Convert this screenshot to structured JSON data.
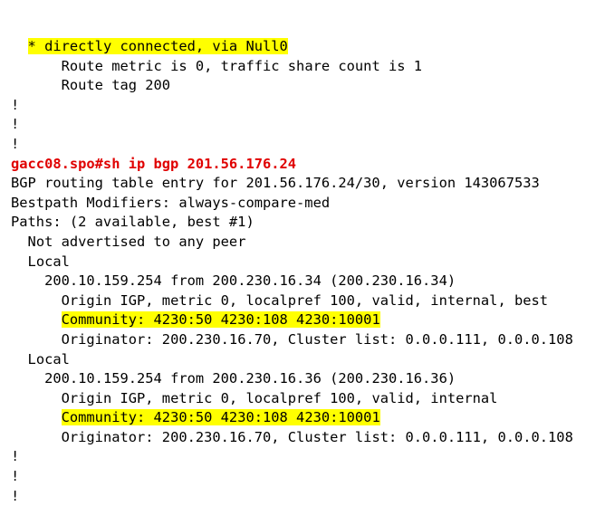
{
  "colors": {
    "highlight": "#ffff00",
    "command": "#e00000",
    "text": "#000000",
    "background": "#ffffff"
  },
  "lines": [
    {
      "indent": "  ",
      "text": "* directly connected, via Null0",
      "style": "highlight"
    },
    {
      "indent": "      ",
      "text": "Route metric is 0, traffic share count is 1",
      "style": "normal"
    },
    {
      "indent": "      ",
      "text": "Route tag 200",
      "style": "normal"
    },
    {
      "indent": "",
      "text": "!",
      "style": "normal"
    },
    {
      "indent": "",
      "text": "!",
      "style": "normal"
    },
    {
      "indent": "",
      "text": "!",
      "style": "normal"
    },
    {
      "indent": "",
      "text": "gacc08.spo#sh ip bgp 201.56.176.24",
      "style": "command"
    },
    {
      "indent": "",
      "text": "BGP routing table entry for 201.56.176.24/30, version 143067533",
      "style": "normal"
    },
    {
      "indent": "",
      "text": "Bestpath Modifiers: always-compare-med",
      "style": "normal"
    },
    {
      "indent": "",
      "text": "Paths: (2 available, best #1)",
      "style": "normal"
    },
    {
      "indent": "  ",
      "text": "Not advertised to any peer",
      "style": "normal"
    },
    {
      "indent": "  ",
      "text": "Local",
      "style": "normal"
    },
    {
      "indent": "    ",
      "text": "200.10.159.254 from 200.230.16.34 (200.230.16.34)",
      "style": "normal"
    },
    {
      "indent": "      ",
      "text": "Origin IGP, metric 0, localpref 100, valid, internal, best",
      "style": "normal"
    },
    {
      "indent": "      ",
      "text": "Community: 4230:50 4230:108 4230:10001",
      "style": "highlight"
    },
    {
      "indent": "      ",
      "text": "Originator: 200.230.16.70, Cluster list: 0.0.0.111, 0.0.0.108",
      "style": "normal"
    },
    {
      "indent": "  ",
      "text": "Local",
      "style": "normal"
    },
    {
      "indent": "    ",
      "text": "200.10.159.254 from 200.230.16.36 (200.230.16.36)",
      "style": "normal"
    },
    {
      "indent": "      ",
      "text": "Origin IGP, metric 0, localpref 100, valid, internal",
      "style": "normal"
    },
    {
      "indent": "      ",
      "text": "Community: 4230:50 4230:108 4230:10001",
      "style": "highlight"
    },
    {
      "indent": "      ",
      "text": "Originator: 200.230.16.70, Cluster list: 0.0.0.111, 0.0.0.108",
      "style": "normal"
    },
    {
      "indent": "",
      "text": "!",
      "style": "normal"
    },
    {
      "indent": "",
      "text": "!",
      "style": "normal"
    },
    {
      "indent": "",
      "text": "!",
      "style": "normal"
    }
  ]
}
